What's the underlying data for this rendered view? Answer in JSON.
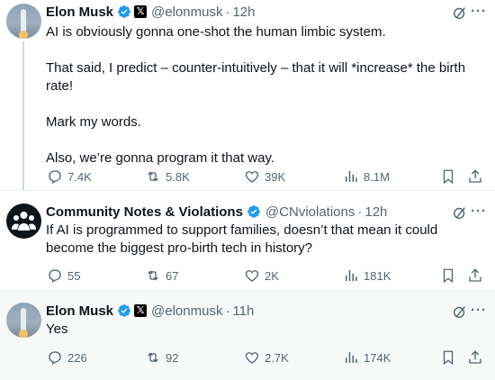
{
  "tweets": [
    {
      "name": "Elon Musk",
      "handle": "@elonmusk",
      "separator": "·",
      "time": "12h",
      "paragraphs": [
        "AI is obviously gonna one-shot the human limbic system.",
        "That said, I predict – counter-intuitively – that it will *increase* the birth rate!",
        "Mark my words.",
        "Also, we’re gonna program it that way."
      ],
      "replies": "7.4K",
      "reposts": "5.8K",
      "likes": "39K",
      "views": "8.1M"
    },
    {
      "name": "Community Notes & Violations",
      "handle": "@CNviolations",
      "separator": "·",
      "time": "12h",
      "paragraphs": [
        "If AI is programmed to support families, doesn’t that mean it could become the biggest pro-birth tech in history?"
      ],
      "replies": "55",
      "reposts": "67",
      "likes": "2K",
      "views": "181K"
    },
    {
      "name": "Elon Musk",
      "handle": "@elonmusk",
      "separator": "·",
      "time": "11h",
      "paragraphs": [
        "Yes"
      ],
      "replies": "226",
      "reposts": "92",
      "likes": "2.7K",
      "views": "174K"
    }
  ],
  "badges": {
    "x_affiliate_glyph": "𝕏"
  },
  "colors": {
    "verified": "#1d9bf0",
    "muted": "#536471",
    "text": "#0f1419",
    "highlight_bg": "#f7f9f9"
  }
}
